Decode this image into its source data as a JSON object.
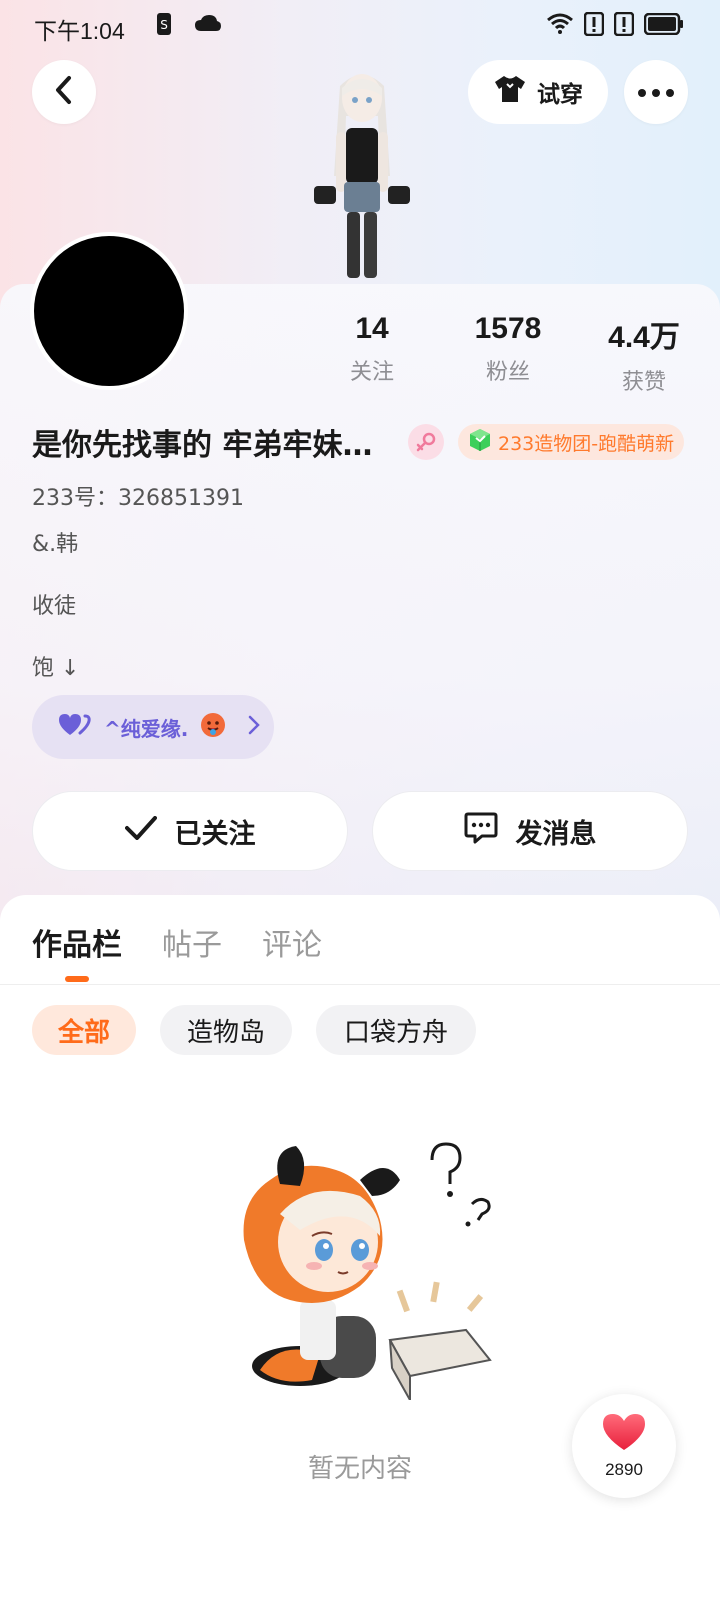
{
  "status_bar": {
    "time": "下午1:04"
  },
  "top_bar": {
    "try_on_label": "试穿"
  },
  "profile": {
    "nickname": "是你先找事的 牢弟牢妹…",
    "team_badge": "233造物团-跑酷萌新",
    "id_line": "233号：326851391",
    "bio_lines": [
      "&.韩",
      "收徒",
      "饱 ↓"
    ],
    "love_pill": "^纯爱缘."
  },
  "stats": [
    {
      "value": "14",
      "label": "关注"
    },
    {
      "value": "1578",
      "label": "粉丝"
    },
    {
      "value": "4.4万",
      "label": "获赞"
    }
  ],
  "actions": {
    "follow_label": "已关注",
    "message_label": "发消息"
  },
  "tabs": [
    {
      "label": "作品栏",
      "active": true
    },
    {
      "label": "帖子",
      "active": false
    },
    {
      "label": "评论",
      "active": false
    }
  ],
  "filters": [
    {
      "label": "全部",
      "active": true
    },
    {
      "label": "造物岛",
      "active": false
    },
    {
      "label": "口袋方舟",
      "active": false
    }
  ],
  "empty_state": {
    "text": "暂无内容"
  },
  "like_button": {
    "count": "2890"
  },
  "colors": {
    "accent": "#ff6b1a",
    "love": "#6b5fd8",
    "team_badge_text": "#ff7a2d"
  }
}
